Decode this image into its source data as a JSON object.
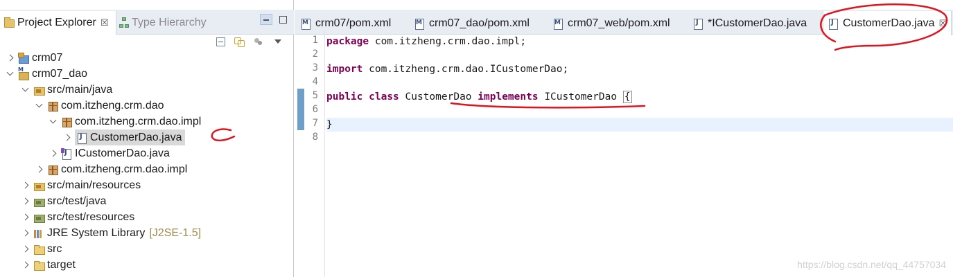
{
  "left_panel": {
    "tabs": [
      {
        "label": "Project Explorer",
        "close": "☒"
      },
      {
        "label": "Type Hierarchy"
      }
    ],
    "tree": [
      {
        "label": "crm07",
        "decor": ""
      },
      {
        "label": "crm07_dao",
        "decor": ""
      },
      {
        "label": "src/main/java",
        "decor": ""
      },
      {
        "label": "com.itzheng.crm.dao",
        "decor": ""
      },
      {
        "label": "com.itzheng.crm.dao.impl",
        "decor": ""
      },
      {
        "label": "CustomerDao.java",
        "decor": ""
      },
      {
        "label": "ICustomerDao.java",
        "decor": ""
      },
      {
        "label": "com.itzheng.crm.dao.impl",
        "decor": ""
      },
      {
        "label": "src/main/resources",
        "decor": ""
      },
      {
        "label": "src/test/java",
        "decor": ""
      },
      {
        "label": "src/test/resources",
        "decor": ""
      },
      {
        "label": "JRE System Library",
        "decor": "[J2SE-1.5]"
      },
      {
        "label": "src",
        "decor": ""
      },
      {
        "label": "target",
        "decor": ""
      }
    ]
  },
  "editor": {
    "tabs": [
      {
        "label": "crm07/pom.xml"
      },
      {
        "label": "crm07_dao/pom.xml"
      },
      {
        "label": "crm07_web/pom.xml"
      },
      {
        "label": "*ICustomerDao.java"
      },
      {
        "label": "CustomerDao.java",
        "close": "☒"
      }
    ],
    "line_numbers": [
      "1",
      "2",
      "3",
      "4",
      "5",
      "6",
      "7",
      "8"
    ],
    "lines": {
      "l1_kw": "package",
      "l1_rest": " com.itzheng.crm.dao.impl;",
      "l3_kw": "import",
      "l3_rest": " com.itzheng.crm.dao.ICustomerDao;",
      "l5_kw1": "public",
      "l5_kw2": "class",
      "l5_name": " CustomerDao ",
      "l5_kw3": "implements",
      "l5_iface": " ICustomerDao ",
      "l5_brace": "{",
      "l7_brace": "}"
    }
  },
  "watermark": "https://blog.csdn.net/qq_44757034",
  "colors": {
    "keyword": "#7f0055",
    "annotation": "#e0141e",
    "change_bar": "#6e9fc9",
    "current_line": "#e8f2fe"
  }
}
